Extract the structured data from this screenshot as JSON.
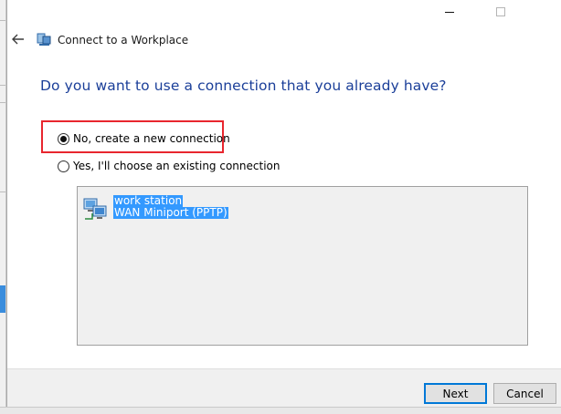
{
  "window": {
    "title": "Connect to a Workplace",
    "minimize_icon": "minimize-icon",
    "maximize_icon": "maximize-icon",
    "back_icon": "back-arrow-icon",
    "app_icon": "network-connection-icon"
  },
  "main": {
    "heading": "Do you want to use a connection that you already have?",
    "options": [
      {
        "label": "No, create a new connection",
        "selected": true
      },
      {
        "label": "Yes, I'll choose an existing connection",
        "selected": false
      }
    ],
    "connections": [
      {
        "name": "work station",
        "device": "WAN Miniport (PPTP)",
        "icon": "network-connection-icon",
        "selected": true
      }
    ]
  },
  "footer": {
    "next_label": "Next",
    "cancel_label": "Cancel"
  },
  "colors": {
    "heading": "#1b3f99",
    "highlight": "#e8262e",
    "selection": "#3399ff",
    "default_button_border": "#0078d7"
  }
}
